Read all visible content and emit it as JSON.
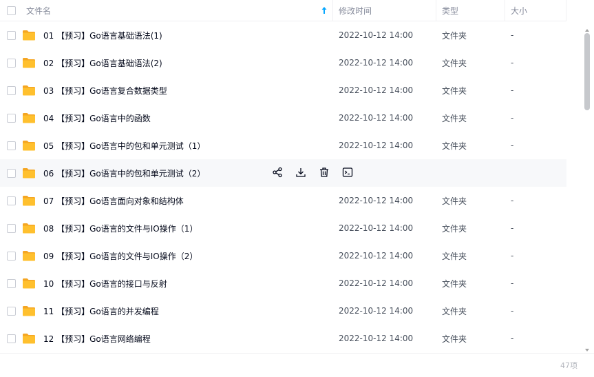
{
  "header": {
    "name_label": "文件名",
    "time_label": "修改时间",
    "type_label": "类型",
    "size_label": "大小"
  },
  "rows": [
    {
      "name": "01 【预习】Go语言基础语法(1)",
      "time": "2022-10-12 14:00",
      "type": "文件夹",
      "size": "-"
    },
    {
      "name": "02 【预习】Go语言基础语法(2)",
      "time": "2022-10-12 14:00",
      "type": "文件夹",
      "size": "-"
    },
    {
      "name": "03 【预习】Go语言复合数据类型",
      "time": "2022-10-12 14:00",
      "type": "文件夹",
      "size": "-"
    },
    {
      "name": "04 【预习】Go语言中的函数",
      "time": "2022-10-12 14:00",
      "type": "文件夹",
      "size": "-"
    },
    {
      "name": "05 【预习】Go语言中的包和单元测试（1）",
      "time": "2022-10-12 14:00",
      "type": "文件夹",
      "size": "-"
    },
    {
      "name": "06 【预习】Go语言中的包和单元测试（2）",
      "time": "",
      "type": "",
      "size": "",
      "hover": true
    },
    {
      "name": "07 【预习】Go语言面向对象和结构体",
      "time": "2022-10-12 14:00",
      "type": "文件夹",
      "size": "-"
    },
    {
      "name": "08 【预习】Go语言的文件与IO操作（1）",
      "time": "2022-10-12 14:00",
      "type": "文件夹",
      "size": "-"
    },
    {
      "name": "09 【预习】Go语言的文件与IO操作（2）",
      "time": "2022-10-12 14:00",
      "type": "文件夹",
      "size": "-"
    },
    {
      "name": "10 【预习】Go语言的接口与反射",
      "time": "2022-10-12 14:00",
      "type": "文件夹",
      "size": "-"
    },
    {
      "name": "11 【预习】Go语言的并发编程",
      "time": "2022-10-12 14:00",
      "type": "文件夹",
      "size": "-"
    },
    {
      "name": "12 【预习】Go语言网络编程",
      "time": "2022-10-12 14:00",
      "type": "文件夹",
      "size": "-"
    }
  ],
  "row_actions": [
    "share-icon",
    "download-icon",
    "delete-icon",
    "terminal-icon"
  ],
  "footer": {
    "count": "47项"
  },
  "colors": {
    "folder": "#ffc02e",
    "folder_dark": "#f5a623",
    "accent": "#06a7ff",
    "hover_row": "#f7f8fa"
  }
}
